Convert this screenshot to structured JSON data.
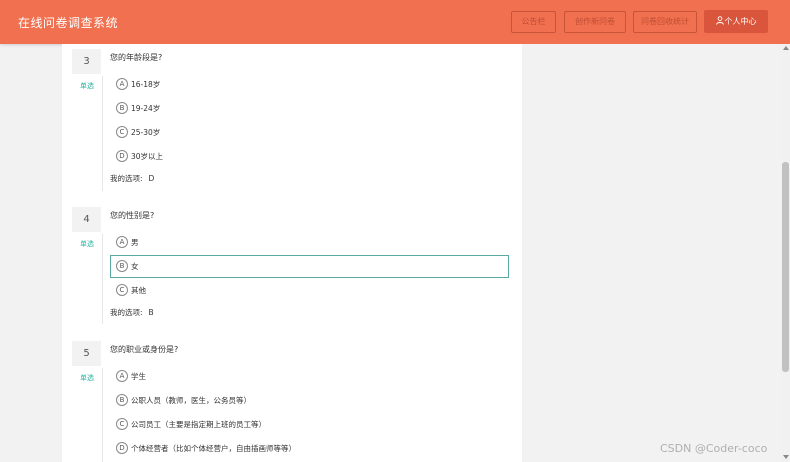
{
  "header": {
    "title": "在线问卷调查系统",
    "nav": [
      "公告栏",
      "创作新问卷",
      "问卷回收统计"
    ],
    "profile_label": "个人中心",
    "accent": "#f0704f"
  },
  "questions": [
    {
      "number": "3",
      "type": "单选",
      "title": "您的年龄段是?",
      "options": [
        {
          "letter": "A",
          "text": "16-18岁"
        },
        {
          "letter": "B",
          "text": "19-24岁"
        },
        {
          "letter": "C",
          "text": "25-30岁"
        },
        {
          "letter": "D",
          "text": "30岁以上"
        }
      ],
      "answer_label": "我的选项:",
      "answer": "D"
    },
    {
      "number": "4",
      "type": "单选",
      "title": "您的性别是?",
      "options": [
        {
          "letter": "A",
          "text": "男"
        },
        {
          "letter": "B",
          "text": "女",
          "selected": true
        },
        {
          "letter": "C",
          "text": "其他"
        }
      ],
      "answer_label": "我的选项:",
      "answer": "B"
    },
    {
      "number": "5",
      "type": "单选",
      "title": "您的职业或身份是?",
      "options": [
        {
          "letter": "A",
          "text": "学生"
        },
        {
          "letter": "B",
          "text": "公职人员（教师，医生，公务员等）"
        },
        {
          "letter": "C",
          "text": "公司员工（主要是指定期上班的员工等）"
        },
        {
          "letter": "D",
          "text": "个体经营者（比如个体经营户，自由插画师等等）"
        }
      ]
    }
  ],
  "watermark": "CSDN @Coder-coco"
}
